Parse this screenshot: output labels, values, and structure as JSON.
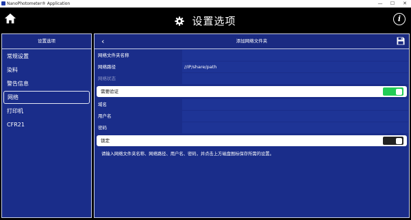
{
  "window": {
    "title": "NanoPhotometer® Application",
    "controls": [
      "—",
      "☐",
      "✕"
    ]
  },
  "header": {
    "title": "设置选项",
    "home_icon": "home-icon",
    "settings_icon": "gear-icon",
    "info_label": "i"
  },
  "sidebar": {
    "heading": "设置选项",
    "items": [
      {
        "label": "常规设置",
        "active": false
      },
      {
        "label": "染料",
        "active": false
      },
      {
        "label": "警告信息",
        "active": false
      },
      {
        "label": "网络",
        "active": true
      },
      {
        "label": "打印机",
        "active": false
      },
      {
        "label": "CFR21",
        "active": false
      }
    ]
  },
  "panel": {
    "title": "添加网络文件夹",
    "back_label": "‹",
    "fields": {
      "folder_name": {
        "label": "网络文件夹名称",
        "value": ""
      },
      "network_path": {
        "label": "网络路径",
        "value": "//IP/share/path"
      },
      "network_status": {
        "label": "网络状态",
        "value": ""
      },
      "domain": {
        "label": "域名",
        "value": ""
      },
      "username": {
        "label": "用户名",
        "value": ""
      },
      "password": {
        "label": "密码",
        "value": ""
      }
    },
    "auth_toggle": {
      "label": "需要验证",
      "state": "on"
    },
    "lock_toggle": {
      "label": "锁定",
      "state": "off"
    },
    "hint": "请输入网络文件夹名称、网络路径、用户名、密码，并点击上方磁盘图标保存所需的设置。"
  },
  "colors": {
    "panel_bg": "#1a2d8a",
    "field_bg": "#1e3496",
    "toggle_on": "#22cc55",
    "toggle_off": "#222222"
  }
}
